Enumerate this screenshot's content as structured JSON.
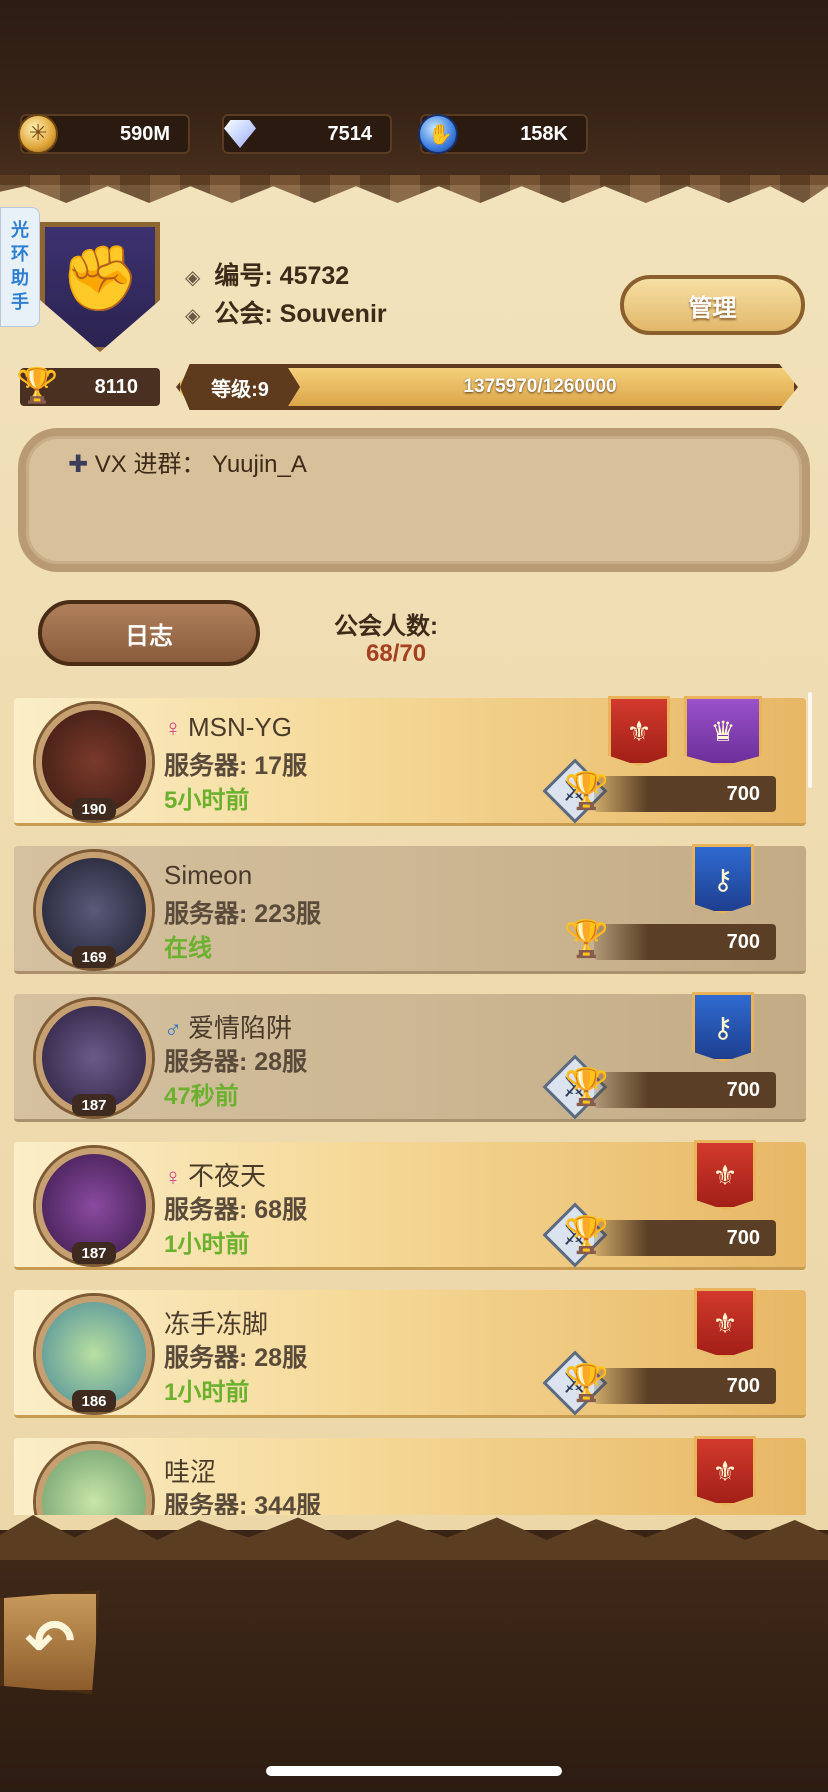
{
  "resources": {
    "gold": {
      "icon": "gold-coin-icon",
      "value": "590M"
    },
    "diamond": {
      "icon": "diamond-icon",
      "value": "7514"
    },
    "crystal": {
      "icon": "blue-crystal-icon",
      "value": "158K"
    }
  },
  "side_tag": "光环助手",
  "guild": {
    "id_line": "编号: 45732",
    "name_line": "公会: Souvenir",
    "manage_label": "管理",
    "trophies": "8110",
    "level_label": "等级:9",
    "level_progress": "1375970/1260000",
    "notice": "VX 进群： Yuujin_A",
    "log_label": "日志",
    "member_count_label": "公会人数:",
    "member_count_value": "68/70"
  },
  "members": [
    {
      "name": "MSN-YG",
      "gender": "♀",
      "server": "服务器: 17服",
      "status": "5小时前",
      "level": "190",
      "score": "700",
      "style": "gold",
      "banners": [
        "red",
        "purple"
      ]
    },
    {
      "name": "Simeon",
      "gender": "",
      "server": "服务器: 223服",
      "status": "在线",
      "level": "169",
      "score": "700",
      "style": "tan",
      "banners": [
        "blue"
      ]
    },
    {
      "name": "爱情陷阱",
      "gender": "♂",
      "server": "服务器: 28服",
      "status": "47秒前",
      "level": "187",
      "score": "700",
      "style": "tan",
      "banners": [
        "blue"
      ]
    },
    {
      "name": "不夜天",
      "gender": "♀",
      "server": "服务器: 68服",
      "status": "1小时前",
      "level": "187",
      "score": "700",
      "style": "gold",
      "banners": [
        "red"
      ]
    },
    {
      "name": "冻手冻脚",
      "gender": "",
      "server": "服务器: 28服",
      "status": "1小时前",
      "level": "186",
      "score": "700",
      "style": "gold",
      "banners": [
        "red"
      ]
    },
    {
      "name": "哇涩",
      "gender": "",
      "server": "服务器: 344服",
      "status": "",
      "level": "",
      "score": "",
      "style": "gold",
      "banners": [
        "red"
      ]
    }
  ],
  "colors": {
    "parchment": "#efdcb1",
    "online_green": "#6bb02e",
    "count_red": "#a4401f",
    "female": "#d8408e",
    "male": "#2a6fc2"
  }
}
